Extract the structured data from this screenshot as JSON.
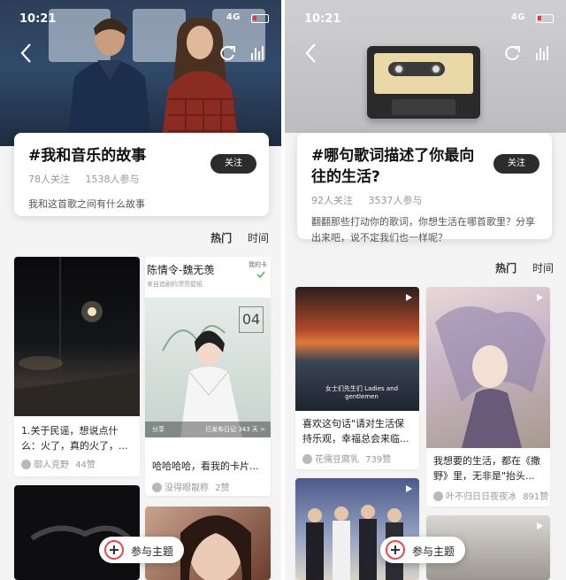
{
  "status": {
    "time": "10:21",
    "network": "4G"
  },
  "left": {
    "topic": {
      "title": "#我和音乐的故事",
      "followers": "78人关注",
      "participants": "1538人参与",
      "description": "我和这首歌之间有什么故事",
      "follow_label": "关注"
    },
    "sort": {
      "hot": "热门",
      "time": "时间"
    },
    "cards": [
      {
        "text": "1.关于民谣，想说点什么：火了，真的火了，...",
        "author": "御人克野",
        "likes": "44赞"
      },
      {
        "title": "陈情令-魏无羡",
        "subtitle": "来自追剧的漂亮壁纸",
        "tag": "我的卡",
        "date_number": "04",
        "share_label": "分享",
        "share_info": "已发布日记 343 天 >",
        "text": "哈哈哈哈，看我的卡片...",
        "author": "没得眼靓称",
        "likes": "2赞"
      }
    ],
    "join_label": "参与主题"
  },
  "right": {
    "topic": {
      "title": "#哪句歌词描述了你最向往的生活?",
      "followers": "92人关注",
      "participants": "3537人参与",
      "description": "翻翻那些打动你的歌词，你想生活在哪首歌里？分享出来吧，说不定我们也一样呢？",
      "follow_label": "关注"
    },
    "sort": {
      "hot": "热门",
      "time": "时间"
    },
    "cards": [
      {
        "overlay": "女士们先生们 Ladies and gentlemen",
        "text": "喜欢这句话\"请对生活保持乐观，幸福总会来临...",
        "author": "花儒豆腐乳",
        "likes": "739赞"
      },
      {
        "text": "我想要的生活，都在《撒野》里，无非是\"抬头...",
        "author": "叶不归日日夜夜冰",
        "likes": "891赞"
      }
    ],
    "join_label": "参与主题"
  },
  "icons": [
    "back-icon",
    "share-icon",
    "stats-icon",
    "plus-icon",
    "check-icon",
    "play-icon"
  ]
}
